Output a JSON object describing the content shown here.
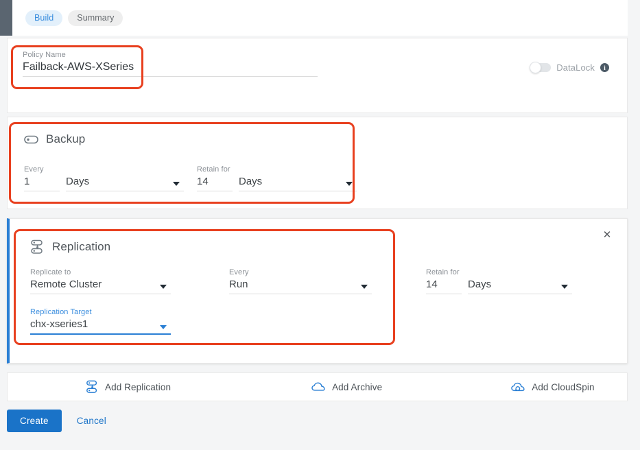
{
  "tabs": [
    {
      "label": "Build",
      "active": true
    },
    {
      "label": "Summary",
      "active": false
    }
  ],
  "policy": {
    "label": "Policy Name",
    "value": "Failback-AWS-XSeries",
    "placeholder": "Policy Name"
  },
  "datalock": {
    "label": "DataLock",
    "enabled": false,
    "info_icon": "info-icon",
    "toggle_icon": "toggle-off-icon"
  },
  "backup": {
    "title": "Backup",
    "icon": "backup-disk-icon",
    "every": {
      "label": "Every",
      "value": "1",
      "unit": "Days",
      "unit_icon": "chevron-down-icon"
    },
    "retain": {
      "label": "Retain for",
      "value": "14",
      "unit": "Days",
      "unit_icon": "chevron-down-icon"
    }
  },
  "replication": {
    "title": "Replication",
    "icon": "replication-nodes-icon",
    "close_icon": "close-icon",
    "replicate_to": {
      "label": "Replicate to",
      "value": "Remote Cluster",
      "icon": "chevron-down-icon"
    },
    "every": {
      "label": "Every",
      "value": "Run",
      "icon": "chevron-down-icon"
    },
    "retain": {
      "label": "Retain for",
      "value": "14",
      "unit": "Days",
      "unit_icon": "chevron-down-icon"
    },
    "target": {
      "label": "Replication Target",
      "value": "chx-xseries1",
      "icon": "chevron-down-icon",
      "focused": true
    }
  },
  "actions": [
    {
      "label": "Add Replication",
      "icon": "replication-nodes-icon"
    },
    {
      "label": "Add Archive",
      "icon": "cloud-icon"
    },
    {
      "label": "Add CloudSpin",
      "icon": "cloud-refresh-icon"
    }
  ],
  "footer": {
    "create_label": "Create",
    "cancel_label": "Cancel"
  },
  "colors": {
    "accent_blue": "#2a7fd4",
    "primary_button": "#1a73c8",
    "tab_active_bg": "#e3f0fb",
    "tab_active_text": "#3a8dde",
    "annotation_red": "#e8401f",
    "page_bg": "#f4f5f6",
    "label_gray": "#8b9096"
  }
}
